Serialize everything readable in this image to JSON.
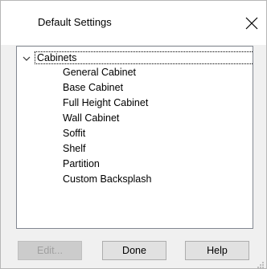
{
  "window": {
    "title": "Default Settings",
    "close_icon": "close-icon"
  },
  "tree": {
    "root": {
      "label": "Cabinets",
      "expanded": true,
      "selected": true,
      "icon": "chevron-down-icon"
    },
    "children": [
      {
        "label": "General Cabinet"
      },
      {
        "label": "Base Cabinet"
      },
      {
        "label": "Full Height Cabinet"
      },
      {
        "label": "Wall Cabinet"
      },
      {
        "label": "Soffit"
      },
      {
        "label": "Shelf"
      },
      {
        "label": "Partition"
      },
      {
        "label": "Custom Backsplash"
      }
    ]
  },
  "buttons": {
    "edit_label": "Edit...",
    "edit_enabled": false,
    "done_label": "Done",
    "help_label": "Help"
  },
  "colors": {
    "dialog_bg": "#f0f0f0",
    "tree_border": "#828790",
    "button_bg": "#e1e1e1"
  }
}
